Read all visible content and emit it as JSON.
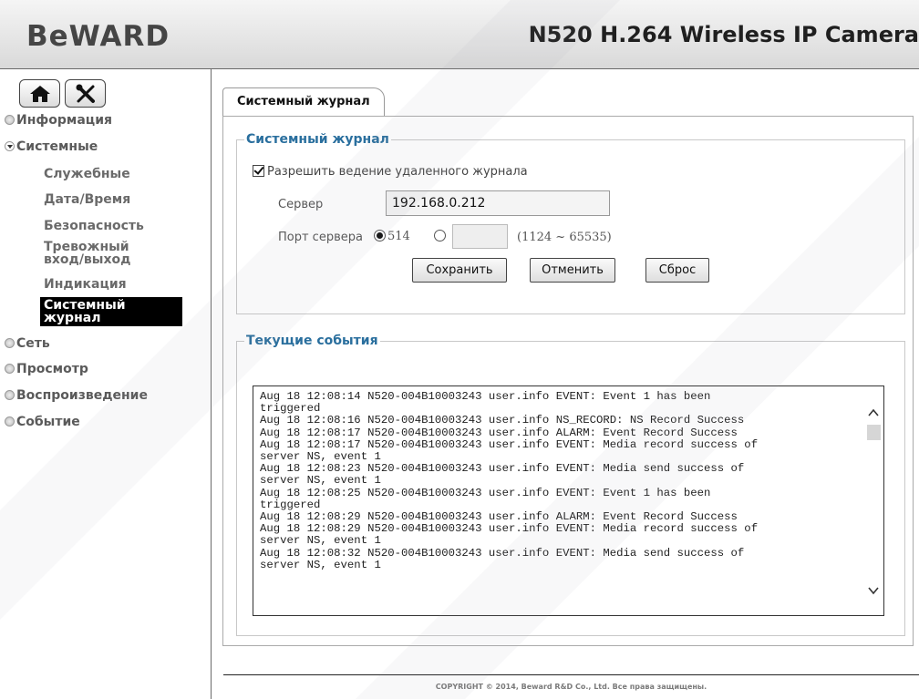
{
  "header": {
    "logo": "BeWARD",
    "camera_title": "N520 H.264 Wireless IP Camera"
  },
  "sidebar": {
    "home_icon": "home-icon",
    "settings_icon": "tools-icon",
    "sections": [
      {
        "label": "Информация",
        "expanded": false
      },
      {
        "label": "Системные",
        "expanded": true
      },
      {
        "label": "Сеть",
        "expanded": false
      },
      {
        "label": "Просмотр",
        "expanded": false
      },
      {
        "label": "Воспроизведение",
        "expanded": false
      },
      {
        "label": "Событие",
        "expanded": false
      }
    ],
    "system_items": [
      "Служебные",
      "Дата/Время",
      "Безопасность",
      "Тревожный вход/выход",
      "Индикация",
      "Системный журнал"
    ],
    "active_item": "Системный журнал"
  },
  "main": {
    "tab_label": "Системный журнал",
    "syslog": {
      "legend": "Системный журнал",
      "enable_label": "Разрешить ведение удаленного журнала",
      "enable_checked": true,
      "server_label": "Сервер",
      "server_value": "192.168.0.212",
      "port_label": "Порт сервера",
      "port_default": "514",
      "port_custom_value": "",
      "port_range": "(1124 ~ 65535)",
      "save_label": "Сохранить",
      "cancel_label": "Отменить",
      "reset_label": "Сброс"
    },
    "events": {
      "legend": "Текущие события",
      "log": "Aug 18 12:08:14 N520-004B10003243 user.info EVENT: Event 1 has been\ntriggered\nAug 18 12:08:16 N520-004B10003243 user.info NS_RECORD: NS Record Success\nAug 18 12:08:17 N520-004B10003243 user.info ALARM: Event Record Success\nAug 18 12:08:17 N520-004B10003243 user.info EVENT: Media record success of\nserver NS, event 1\nAug 18 12:08:23 N520-004B10003243 user.info EVENT: Media send success of\nserver NS, event 1\nAug 18 12:08:25 N520-004B10003243 user.info EVENT: Event 1 has been\ntriggered\nAug 18 12:08:29 N520-004B10003243 user.info ALARM: Event Record Success\nAug 18 12:08:29 N520-004B10003243 user.info EVENT: Media record success of\nserver NS, event 1\nAug 18 12:08:32 N520-004B10003243 user.info EVENT: Media send success of\nserver NS, event 1"
    }
  },
  "footer": {
    "copyright": "COPYRIGHT © 2014, Beward R&D Co., Ltd. Все права защищены."
  }
}
